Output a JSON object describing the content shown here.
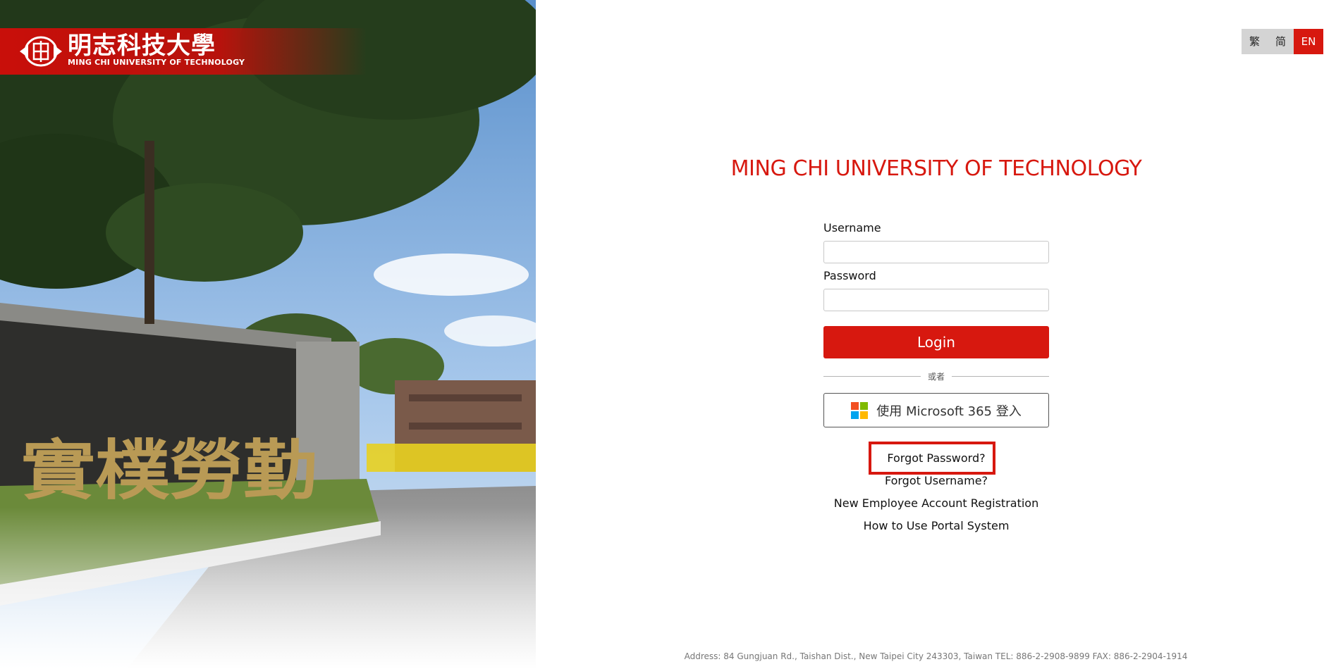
{
  "branding": {
    "chinese_name": "明志科技大學",
    "english_name": "MING CHI UNIVERSITY OF TECHNOLOGY",
    "emblem": "ming-chi-emblem",
    "accent_color": "#d7180f"
  },
  "photo": {
    "gate_inscription": "實樸勞勤"
  },
  "language": {
    "options": [
      "繁",
      "简",
      "EN"
    ],
    "selected": "EN"
  },
  "login": {
    "title": "MING CHI UNIVERSITY OF TECHNOLOGY",
    "username_label": "Username",
    "username_value": "",
    "password_label": "Password",
    "password_value": "",
    "login_button": "Login",
    "or_text": "或者",
    "microsoft_button": "使用 Microsoft 365 登入",
    "microsoft_icon": "microsoft-logo-icon"
  },
  "links": {
    "forgot_password": "Forgot Password?",
    "forgot_username": "Forgot Username?",
    "new_employee": "New Employee Account Registration",
    "how_to_use": "How to Use Portal System"
  },
  "footer": {
    "address": "Address: 84 Gungjuan Rd., Taishan Dist., New Taipei City 243303, Taiwan TEL: 886-2-2908-9899 FAX: 886-2-2904-1914"
  }
}
